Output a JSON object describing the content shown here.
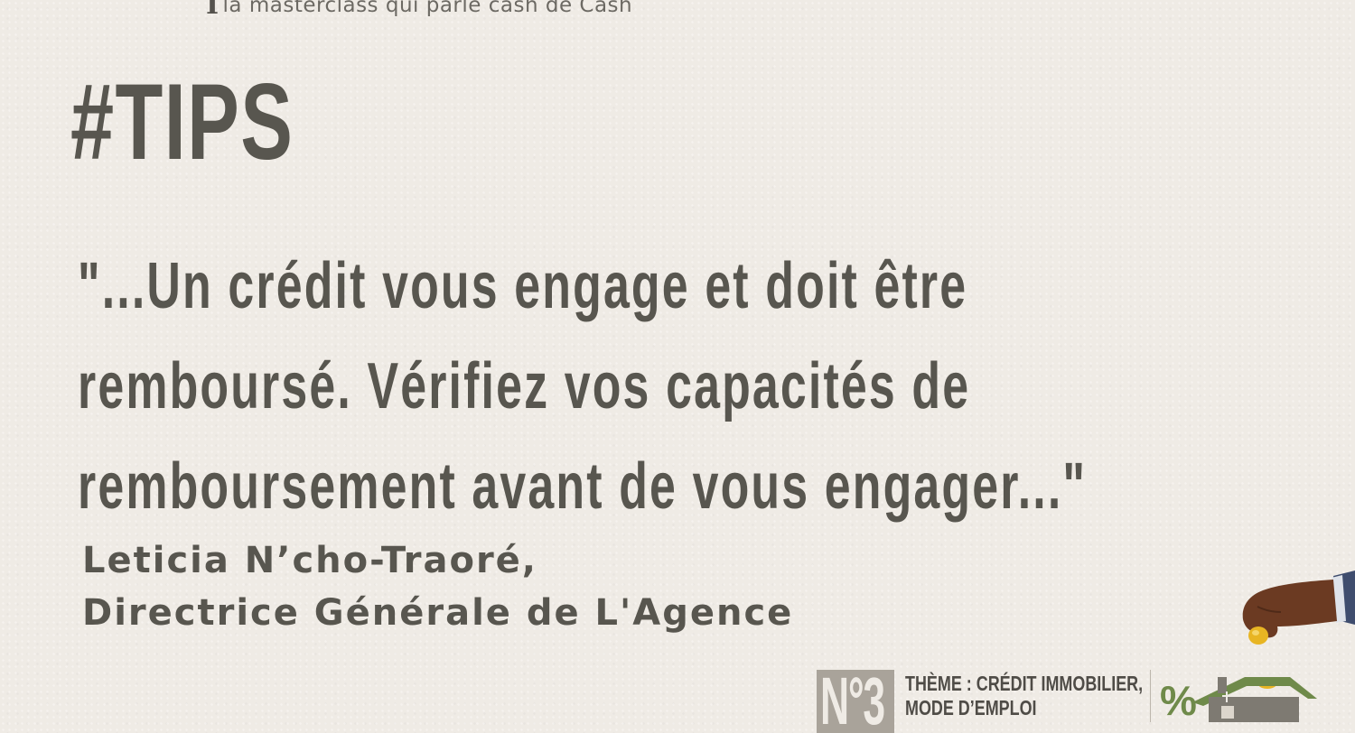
{
  "header": {
    "tagline": "la masterclass qui parle cash de Cash"
  },
  "title": "#TIPS",
  "quote": {
    "lines": [
      "\"...Un crédit vous engage et doit être",
      "remboursé. Vérifiez vos capacités de",
      "remboursement avant de vous engager...\""
    ]
  },
  "author": {
    "name": "Leticia N’cho-Traoré,",
    "role": "Directrice Générale de L'Agence"
  },
  "footer": {
    "episode": "N°3",
    "theme_lines": [
      "THÈME : CRÉDIT IMMOBILIER,",
      "MODE D’EMPLOI"
    ],
    "percent_symbol": "%"
  },
  "colors": {
    "background": "#efebe5",
    "text": "#58564f",
    "badge": "#a9a39a",
    "roof": "#6f8a4a",
    "skin": "#6b3a22",
    "coin": "#e8b523",
    "sleeve": "#3f4d6e"
  },
  "icons": {
    "logo_mark": "serif-cap-glyph",
    "illustration": "hand-dropping-coin-into-house-piggy-bank-icon"
  }
}
